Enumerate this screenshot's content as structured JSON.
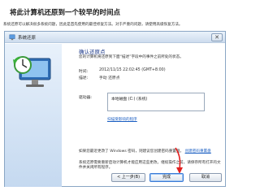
{
  "page": {
    "heading": "将此计算机还原到一个较早的时间点",
    "description": "系统还原可以解决很多系统问题，因此是首先使用的最佳修复方法。对于严重的问题，请使用高级恢复方法。"
  },
  "dialog": {
    "title": "系统还原",
    "close_label": "✕",
    "section_title": "确认还原点",
    "section_subtitle": "您的计算机将还原到下面“描述”字段中的事件之前所处的状态。",
    "time_label": "时间:",
    "time_value": "2012/11/15 22:02:45 (GMT+8:00)",
    "desc_label": "描述:",
    "desc_value": "手动  还原点",
    "drives_label": "驱动器:",
    "drives": [
      "本地磁盘 (C:) (系统)"
    ],
    "scan_link": "扫描受影响的程序",
    "note1_text": "如果您最近更改了 Windows 密码，则建议您创建密码重置盘。",
    "note1_link": "创建密码重置盘",
    "note2_text": "系统还原需要重新启动计算机才能应用这些更改。继续操作之前，请保存所有打开的文件并关闭所有程序。",
    "buttons": {
      "back": "< 上一步(B)",
      "finish": "完成",
      "cancel": "取消"
    }
  },
  "colors": {
    "accent_link": "#1a5ec2",
    "annotation_arrow": "#e02020"
  }
}
